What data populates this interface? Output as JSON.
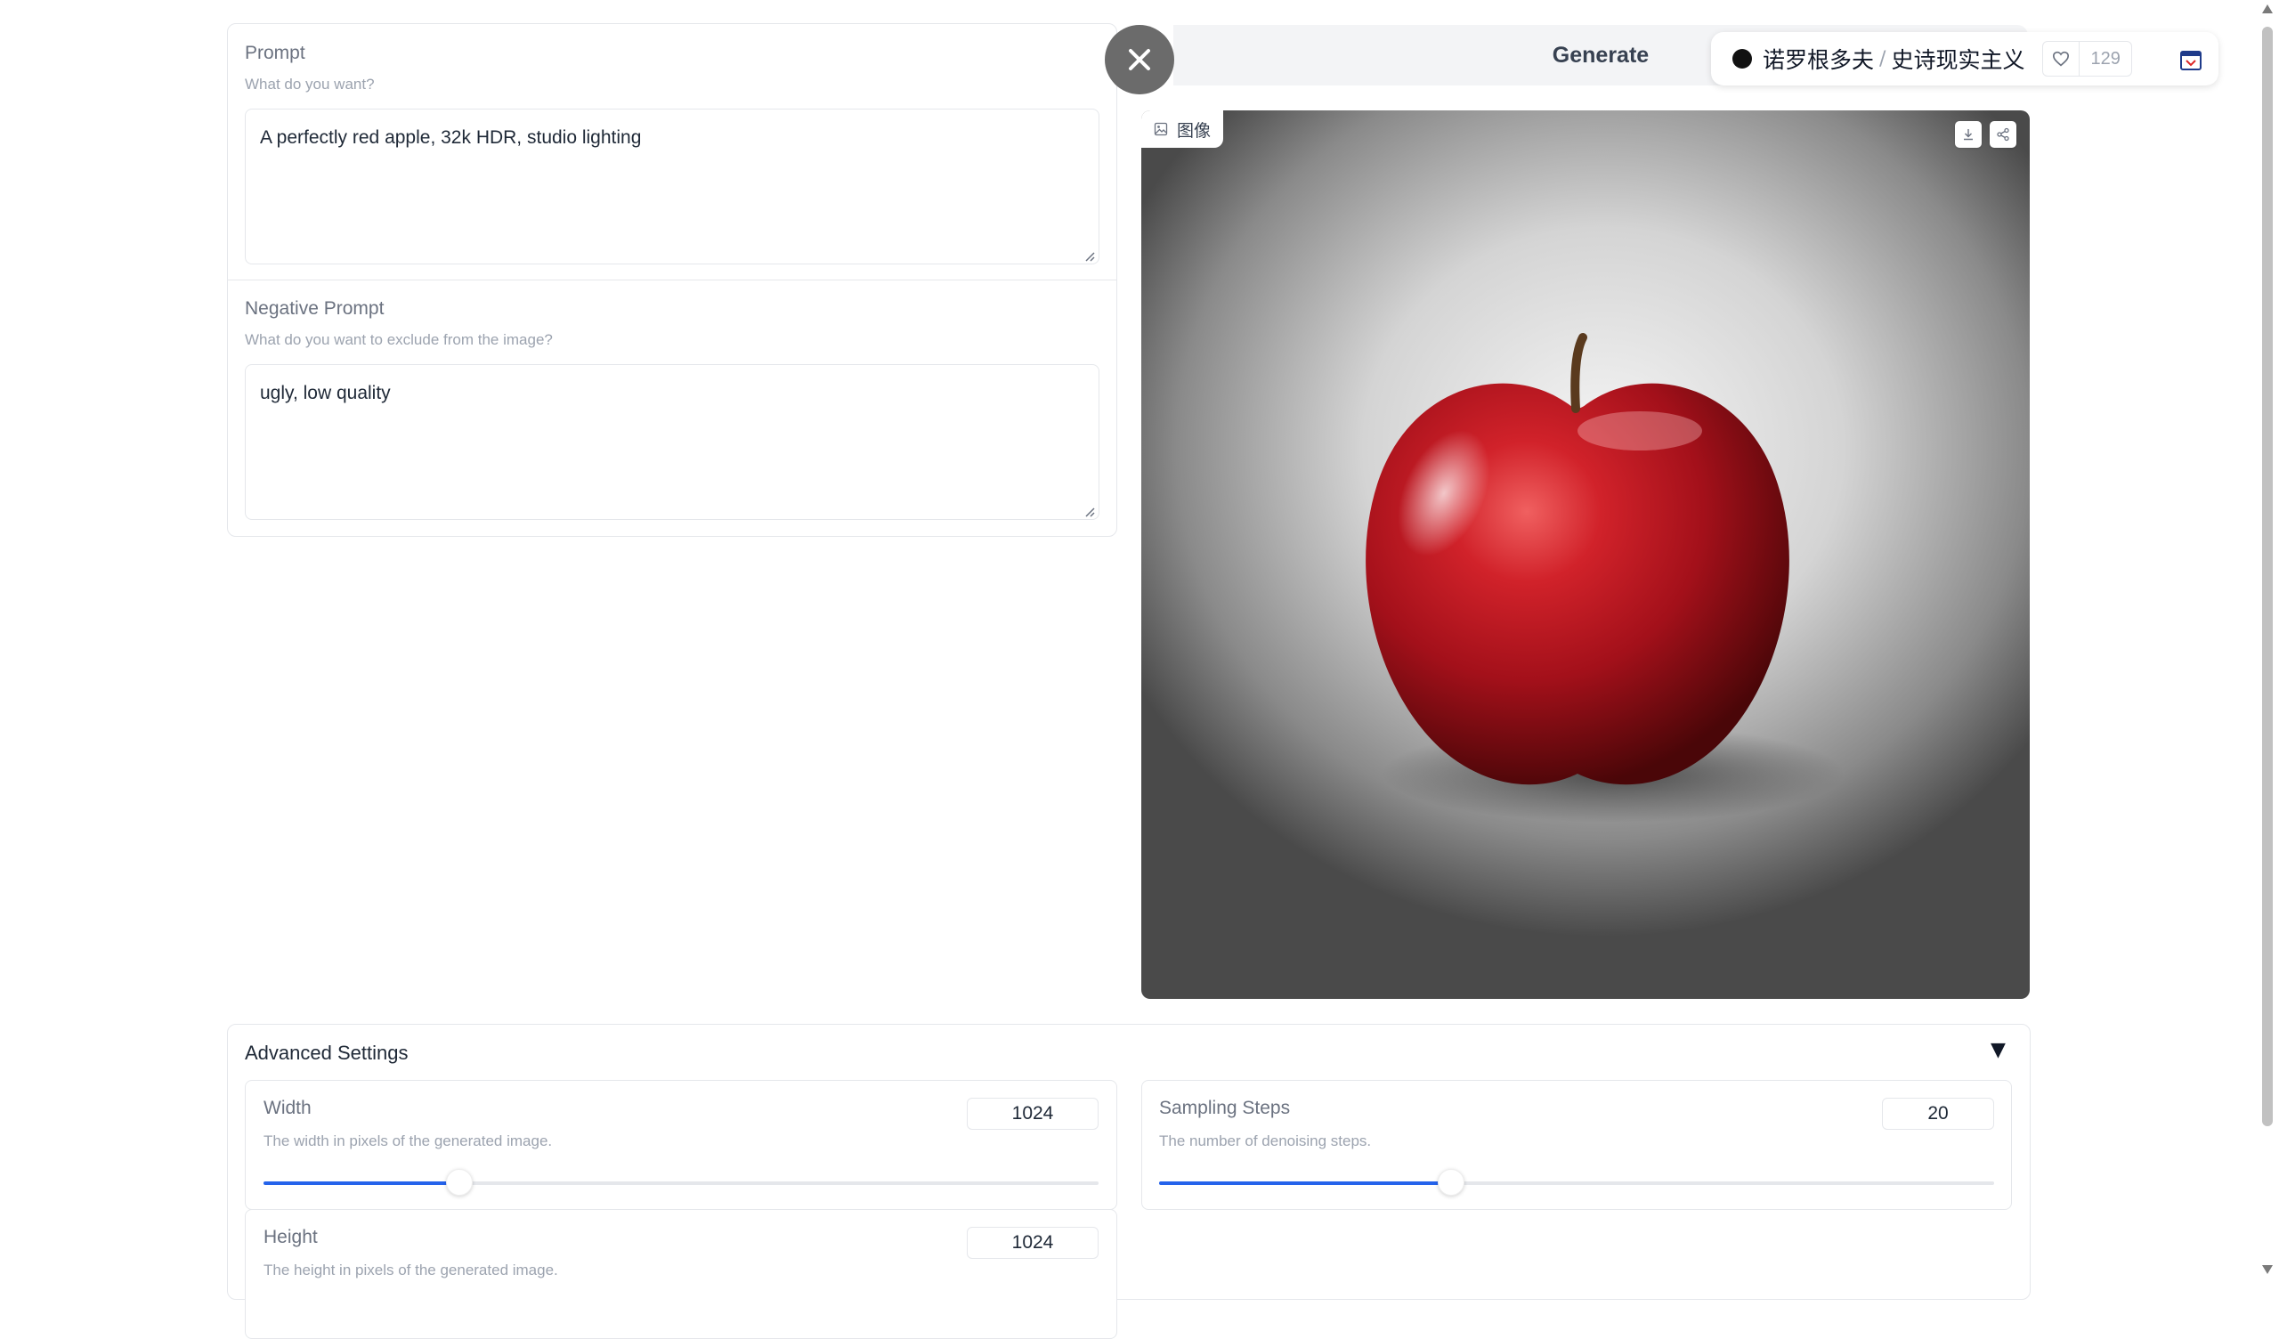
{
  "prompt": {
    "label": "Prompt",
    "hint": "What do you want?",
    "value": "A perfectly red apple, 32k HDR, studio lighting"
  },
  "negative_prompt": {
    "label": "Negative Prompt",
    "hint": "What do you want to exclude from the image?",
    "value": "ugly, low quality"
  },
  "header": {
    "generate_label": "Generate"
  },
  "badge": {
    "name": "诺罗根多夫",
    "separator": "/",
    "style": "史诗现实主义",
    "like_count": "129"
  },
  "image_panel": {
    "tag_label": "图像",
    "subject": "red apple"
  },
  "advanced": {
    "title": "Advanced Settings",
    "toggle": "▼",
    "width": {
      "label": "Width",
      "hint": "The width in pixels of the generated image.",
      "value": "1024",
      "fraction": 0.235
    },
    "height": {
      "label": "Height",
      "hint": "The height in pixels of the generated image.",
      "value": "1024"
    },
    "sampling_steps": {
      "label": "Sampling Steps",
      "hint": "The number of denoising steps.",
      "value": "20",
      "fraction": 0.35
    }
  },
  "colors": {
    "accent": "#2563eb",
    "close_button": "#6b6b6b"
  }
}
